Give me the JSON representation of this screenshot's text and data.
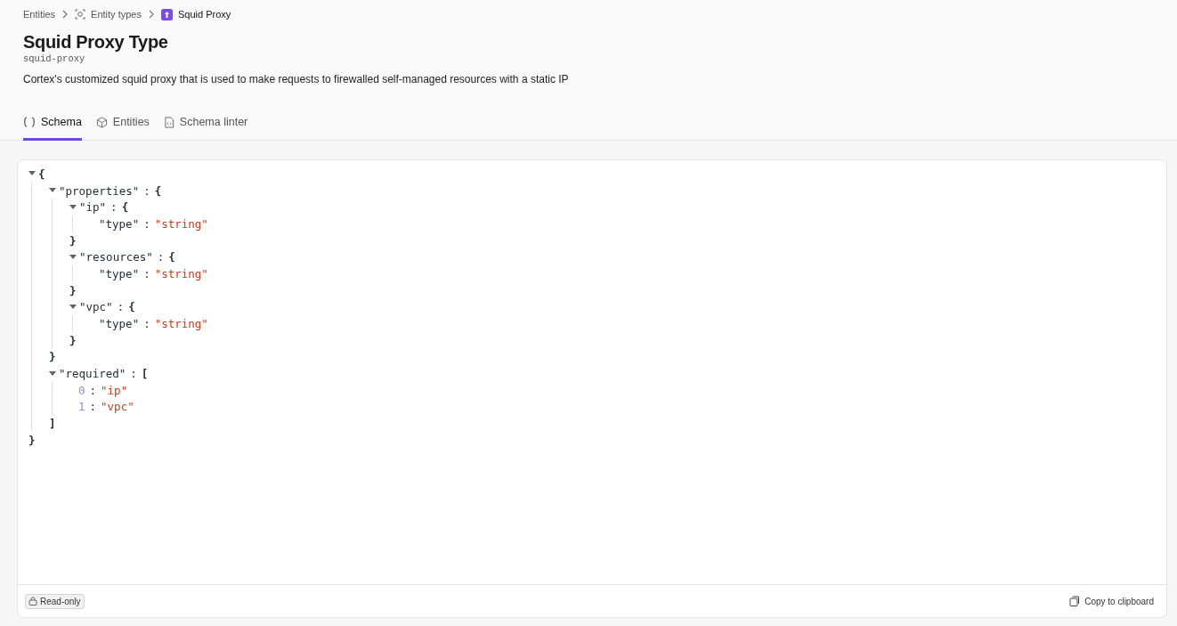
{
  "breadcrumbs": [
    {
      "label": "Entities"
    },
    {
      "label": "Entity types"
    },
    {
      "label": "Squid Proxy"
    }
  ],
  "title": "Squid Proxy Type",
  "tag": "squid-proxy",
  "description": "Cortex's customized squid proxy that is used to make requests to firewalled self-managed resources with a static IP",
  "tabs": [
    {
      "label": "Schema",
      "selected": true
    },
    {
      "label": "Entities",
      "selected": false
    },
    {
      "label": "Schema linter",
      "selected": false
    }
  ],
  "schema": {
    "open": "{",
    "close": "}",
    "expanded": true,
    "children": [
      {
        "key": "\"properties\"",
        "sep": ":",
        "open": "{",
        "close": "}",
        "expanded": true,
        "children": [
          {
            "key": "\"ip\"",
            "sep": ":",
            "open": "{",
            "close": "}",
            "expanded": true,
            "children": [
              {
                "key": "\"type\"",
                "sep": ":",
                "value": "\"string\""
              }
            ]
          },
          {
            "key": "\"resources\"",
            "sep": ":",
            "open": "{",
            "close": "}",
            "expanded": true,
            "children": [
              {
                "key": "\"type\"",
                "sep": ":",
                "value": "\"string\""
              }
            ]
          },
          {
            "key": "\"vpc\"",
            "sep": ":",
            "open": "{",
            "close": "}",
            "expanded": true,
            "children": [
              {
                "key": "\"type\"",
                "sep": ":",
                "value": "\"string\""
              }
            ]
          }
        ]
      },
      {
        "key": "\"required\"",
        "sep": ":",
        "open": "[",
        "close": "]",
        "expanded": true,
        "children": [
          {
            "index": "0",
            "sep": ":",
            "value": "\"ip\""
          },
          {
            "index": "1",
            "sep": ":",
            "value": "\"vpc\""
          }
        ]
      }
    ]
  },
  "footer": {
    "badge": "Read-only",
    "action": "Copy to clipboard"
  }
}
